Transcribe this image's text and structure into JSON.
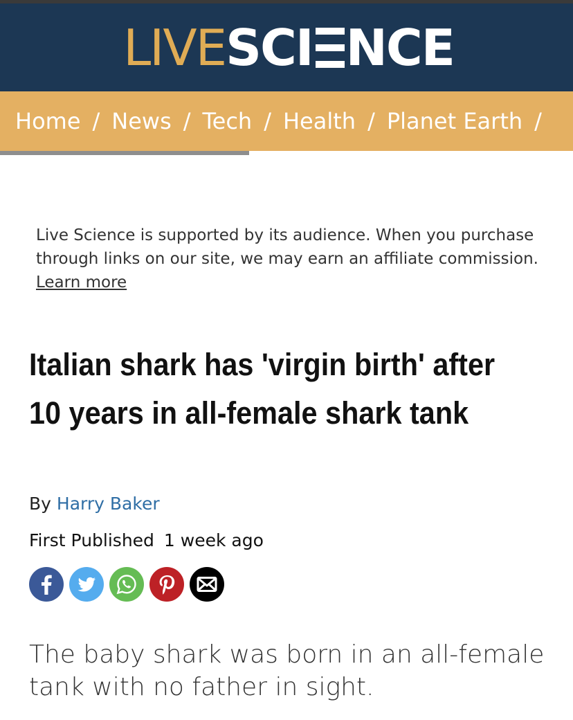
{
  "header": {
    "logo_live": "LIVE",
    "logo_sci": "SCI",
    "logo_nce": "NCE",
    "brand_navy": "#1c3754",
    "brand_gold": "#e4b062"
  },
  "nav": {
    "items": [
      {
        "label": "Home"
      },
      {
        "label": "News"
      },
      {
        "label": "Tech"
      },
      {
        "label": "Health"
      },
      {
        "label": "Planet Earth"
      }
    ],
    "separator": "/"
  },
  "disclaimer": {
    "text": "Live Science is supported by its audience. When you purchase through links on our site, we may earn an affiliate commission. ",
    "link_label": "Learn more"
  },
  "article": {
    "headline": "Italian shark has 'virgin birth' after 10 years in all-female shark tank",
    "by_prefix": "By",
    "author": "Harry Baker",
    "published_label": "First Published",
    "published_time": "1 week ago",
    "standfirst": "The baby shark was born in an all-female tank with no father in sight."
  },
  "share": {
    "buttons": [
      {
        "icon": "facebook-icon",
        "color": "#3b5998"
      },
      {
        "icon": "twitter-icon",
        "color": "#55acee"
      },
      {
        "icon": "whatsapp-icon",
        "color": "#65bc54"
      },
      {
        "icon": "pinterest-icon",
        "color": "#bd2126"
      },
      {
        "icon": "email-icon",
        "color": "#000000"
      }
    ]
  }
}
